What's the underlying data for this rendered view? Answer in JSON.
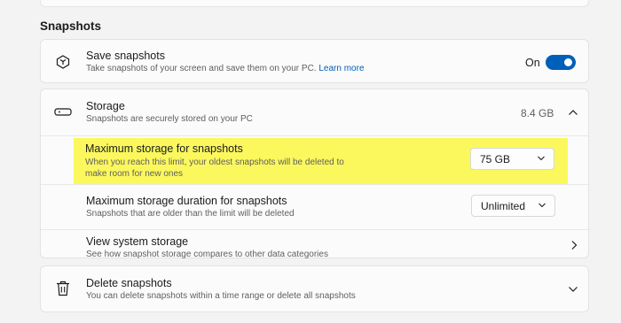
{
  "section_title": "Snapshots",
  "save_snapshots": {
    "title": "Save snapshots",
    "desc": "Take snapshots of your screen and save them on your PC.",
    "learn_more": "Learn more",
    "toggle_label": "On",
    "icon": "snapshot-icon"
  },
  "storage": {
    "title": "Storage",
    "desc": "Snapshots are securely stored on your PC",
    "value": "8.4 GB",
    "icon": "storage-drive-icon"
  },
  "max_storage": {
    "title": "Maximum storage for snapshots",
    "desc_line1": "When you reach this limit, your oldest snapshots will be deleted to",
    "desc_line2": "make room for new ones",
    "selected": "75 GB"
  },
  "max_duration": {
    "title": "Maximum storage duration for snapshots",
    "desc": "Snapshots that are older than the limit will be deleted",
    "selected": "Unlimited"
  },
  "system_storage": {
    "title": "View system storage",
    "desc": "See how snapshot storage compares to other data categories"
  },
  "delete_snapshots": {
    "title": "Delete snapshots",
    "desc": "You can delete snapshots within a time range or delete all snapshots",
    "icon": "trash-icon"
  },
  "colors": {
    "accent": "#005fb8",
    "highlight": "#fbf85e"
  }
}
